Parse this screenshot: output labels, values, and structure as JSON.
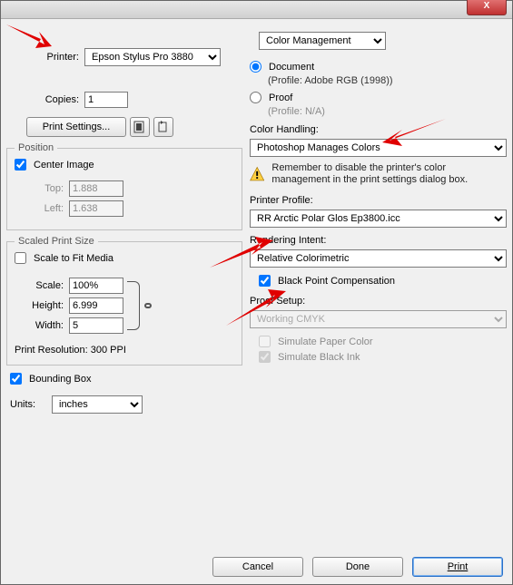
{
  "titlebar": {
    "close": "X"
  },
  "printer": {
    "label": "Printer:",
    "value": "Epson Stylus Pro 3880"
  },
  "copies": {
    "label": "Copies:",
    "value": "1"
  },
  "printSettings": {
    "label": "Print Settings..."
  },
  "position": {
    "legend": "Position",
    "center": "Center Image",
    "top_label": "Top:",
    "top_value": "1.888",
    "left_label": "Left:",
    "left_value": "1.638"
  },
  "scaled": {
    "legend": "Scaled Print Size",
    "fit": "Scale to Fit Media",
    "scale_label": "Scale:",
    "scale_value": "100%",
    "height_label": "Height:",
    "height_value": "6.999",
    "width_label": "Width:",
    "width_value": "5",
    "resolution": "Print Resolution: 300 PPI"
  },
  "bounding": "Bounding Box",
  "units": {
    "label": "Units:",
    "value": "inches"
  },
  "cm": {
    "dropdown": "Color Management",
    "document": "Document",
    "doc_profile": "(Profile: Adobe RGB (1998))",
    "proof": "Proof",
    "proof_profile": "(Profile: N/A)",
    "handling_label": "Color Handling:",
    "handling_value": "Photoshop Manages Colors",
    "warn": "Remember to disable the printer's color management in the print settings dialog box.",
    "profile_label": "Printer Profile:",
    "profile_value": "RR Arctic Polar Glos Ep3800.icc",
    "intent_label": "Rendering Intent:",
    "intent_value": "Relative Colorimetric",
    "bpc": "Black Point Compensation",
    "proof_setup_label": "Proof Setup:",
    "proof_setup_value": "Working CMYK",
    "sim_paper": "Simulate Paper Color",
    "sim_black": "Simulate Black Ink"
  },
  "buttons": {
    "cancel": "Cancel",
    "done": "Done",
    "print": "Print"
  }
}
